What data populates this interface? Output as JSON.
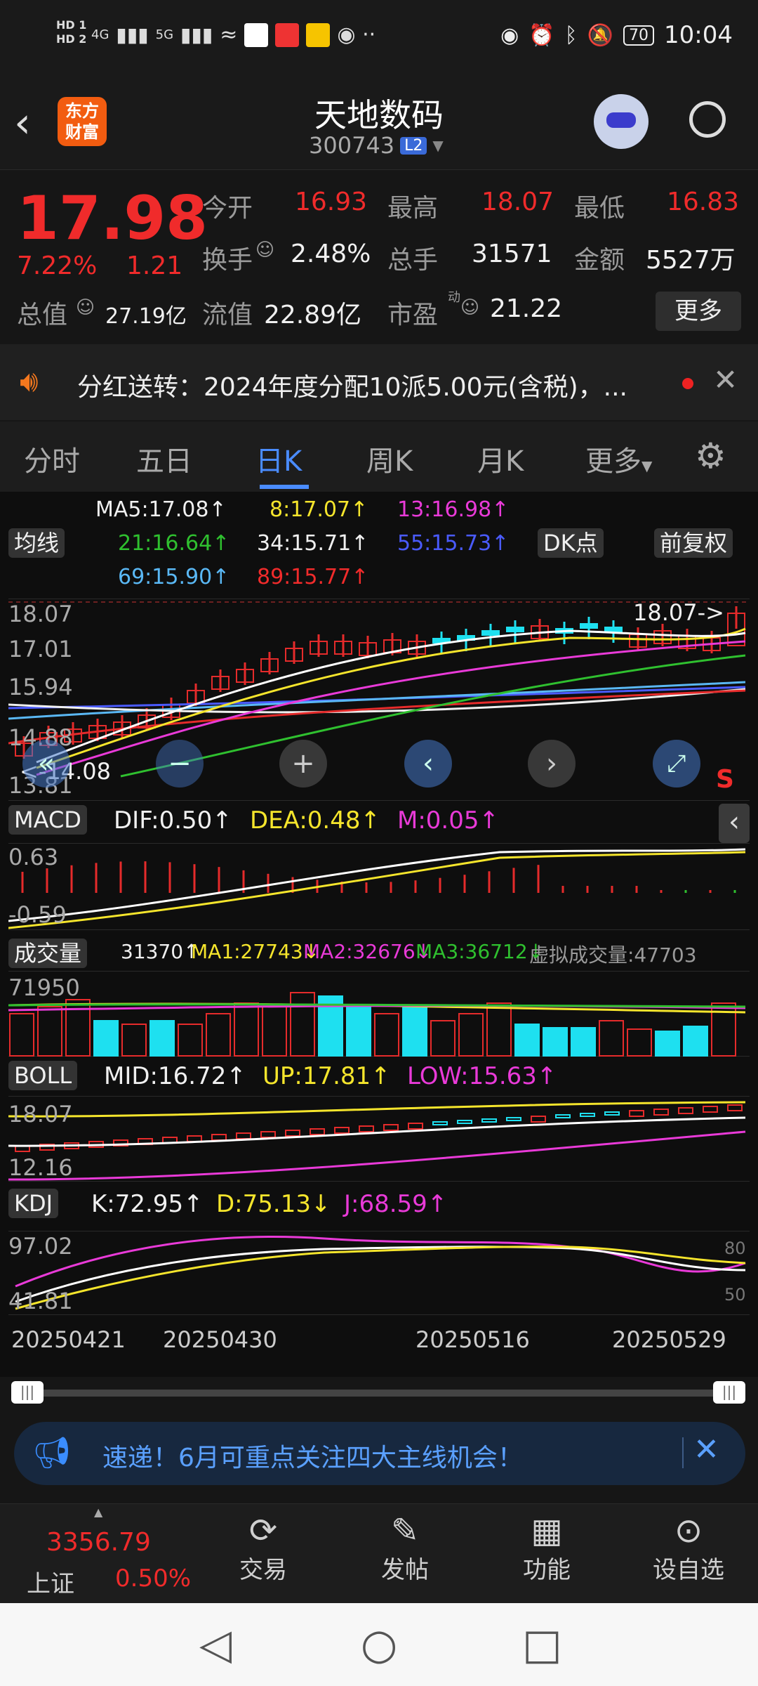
{
  "status": {
    "time": "10:04",
    "battery": "70",
    "signal_left": "HD 1",
    "signal_left2": "HD 2",
    "net1": "4G",
    "net2": "5G"
  },
  "header": {
    "brand_line1": "东方",
    "brand_line2": "财富",
    "title": "天地数码",
    "code": "300743",
    "level": "L2"
  },
  "quote": {
    "price": "17.98",
    "pct": "7.22%",
    "chg": "1.21",
    "open_label": "今开",
    "open": "16.93",
    "high_label": "最高",
    "high": "18.07",
    "low_label": "最低",
    "low": "16.83",
    "turn_label": "换手",
    "turn": "2.48%",
    "vol_label": "总手",
    "vol": "31571",
    "amt_label": "金额",
    "amt": "5527万",
    "mkt_label": "总值",
    "mkt": "27.19亿",
    "flow_label": "流值",
    "flow": "22.89亿",
    "pe_label": "市盈",
    "pe_sup": "动",
    "pe": "21.22",
    "more": "更多"
  },
  "notice": {
    "text": "分红送转：2024年度分配10派5.00元(含税)，..."
  },
  "tabs": [
    "分时",
    "五日",
    "日K",
    "周K",
    "月K",
    "更多"
  ],
  "active_tab": "日K",
  "ma": {
    "label": "均线",
    "dk": "DK点",
    "fq": "前复权",
    "ma5": "MA5:17.08↑",
    "ma8": "8:17.07↑",
    "ma13": "13:16.98↑",
    "ma21": "21:16.64↑",
    "ma34": "34:15.71↑",
    "ma55": "55:15.73↑",
    "ma69": "69:15.90↑",
    "ma89": "89:15.77↑"
  },
  "kchart": {
    "y1": "18.07",
    "y2": "17.01",
    "y3": "15.94",
    "y4": "14.88",
    "y5": "13.81",
    "hi_mark": "18.07->",
    "lo_mark": "<-14.08",
    "s": "S"
  },
  "macd": {
    "label": "MACD",
    "dif": "DIF:0.50↑",
    "dea": "DEA:0.48↑",
    "m": "M:0.05↑",
    "y1": "0.63",
    "y2": "-0.59"
  },
  "vol": {
    "label": "成交量",
    "v": "31370↑",
    "ma1": "MA1:27743↓",
    "ma2": "MA2:32676↓",
    "ma3": "MA3:36712↓",
    "virt": "虚拟成交量:47703",
    "y1": "71950"
  },
  "boll": {
    "label": "BOLL",
    "mid": "MID:16.72↑",
    "up": "UP:17.81↑",
    "low": "LOW:15.63↑",
    "y1": "18.07",
    "y2": "12.16"
  },
  "kdj": {
    "label": "KDJ",
    "k": "K:72.95↑",
    "d": "D:75.13↓",
    "j": "J:68.59↑",
    "y1": "97.02",
    "y2": "41.81",
    "r1": "80",
    "r2": "50"
  },
  "dates": [
    "20250421",
    "20250430",
    "20250516",
    "20250529"
  ],
  "promo": {
    "text": "速递！6月可重点关注四大主线机会！"
  },
  "bottom": {
    "index_val": "3356.79",
    "index_name": "上证",
    "index_pct": "0.50%",
    "trade": "交易",
    "post": "发帖",
    "func": "功能",
    "watch": "设自选"
  }
}
